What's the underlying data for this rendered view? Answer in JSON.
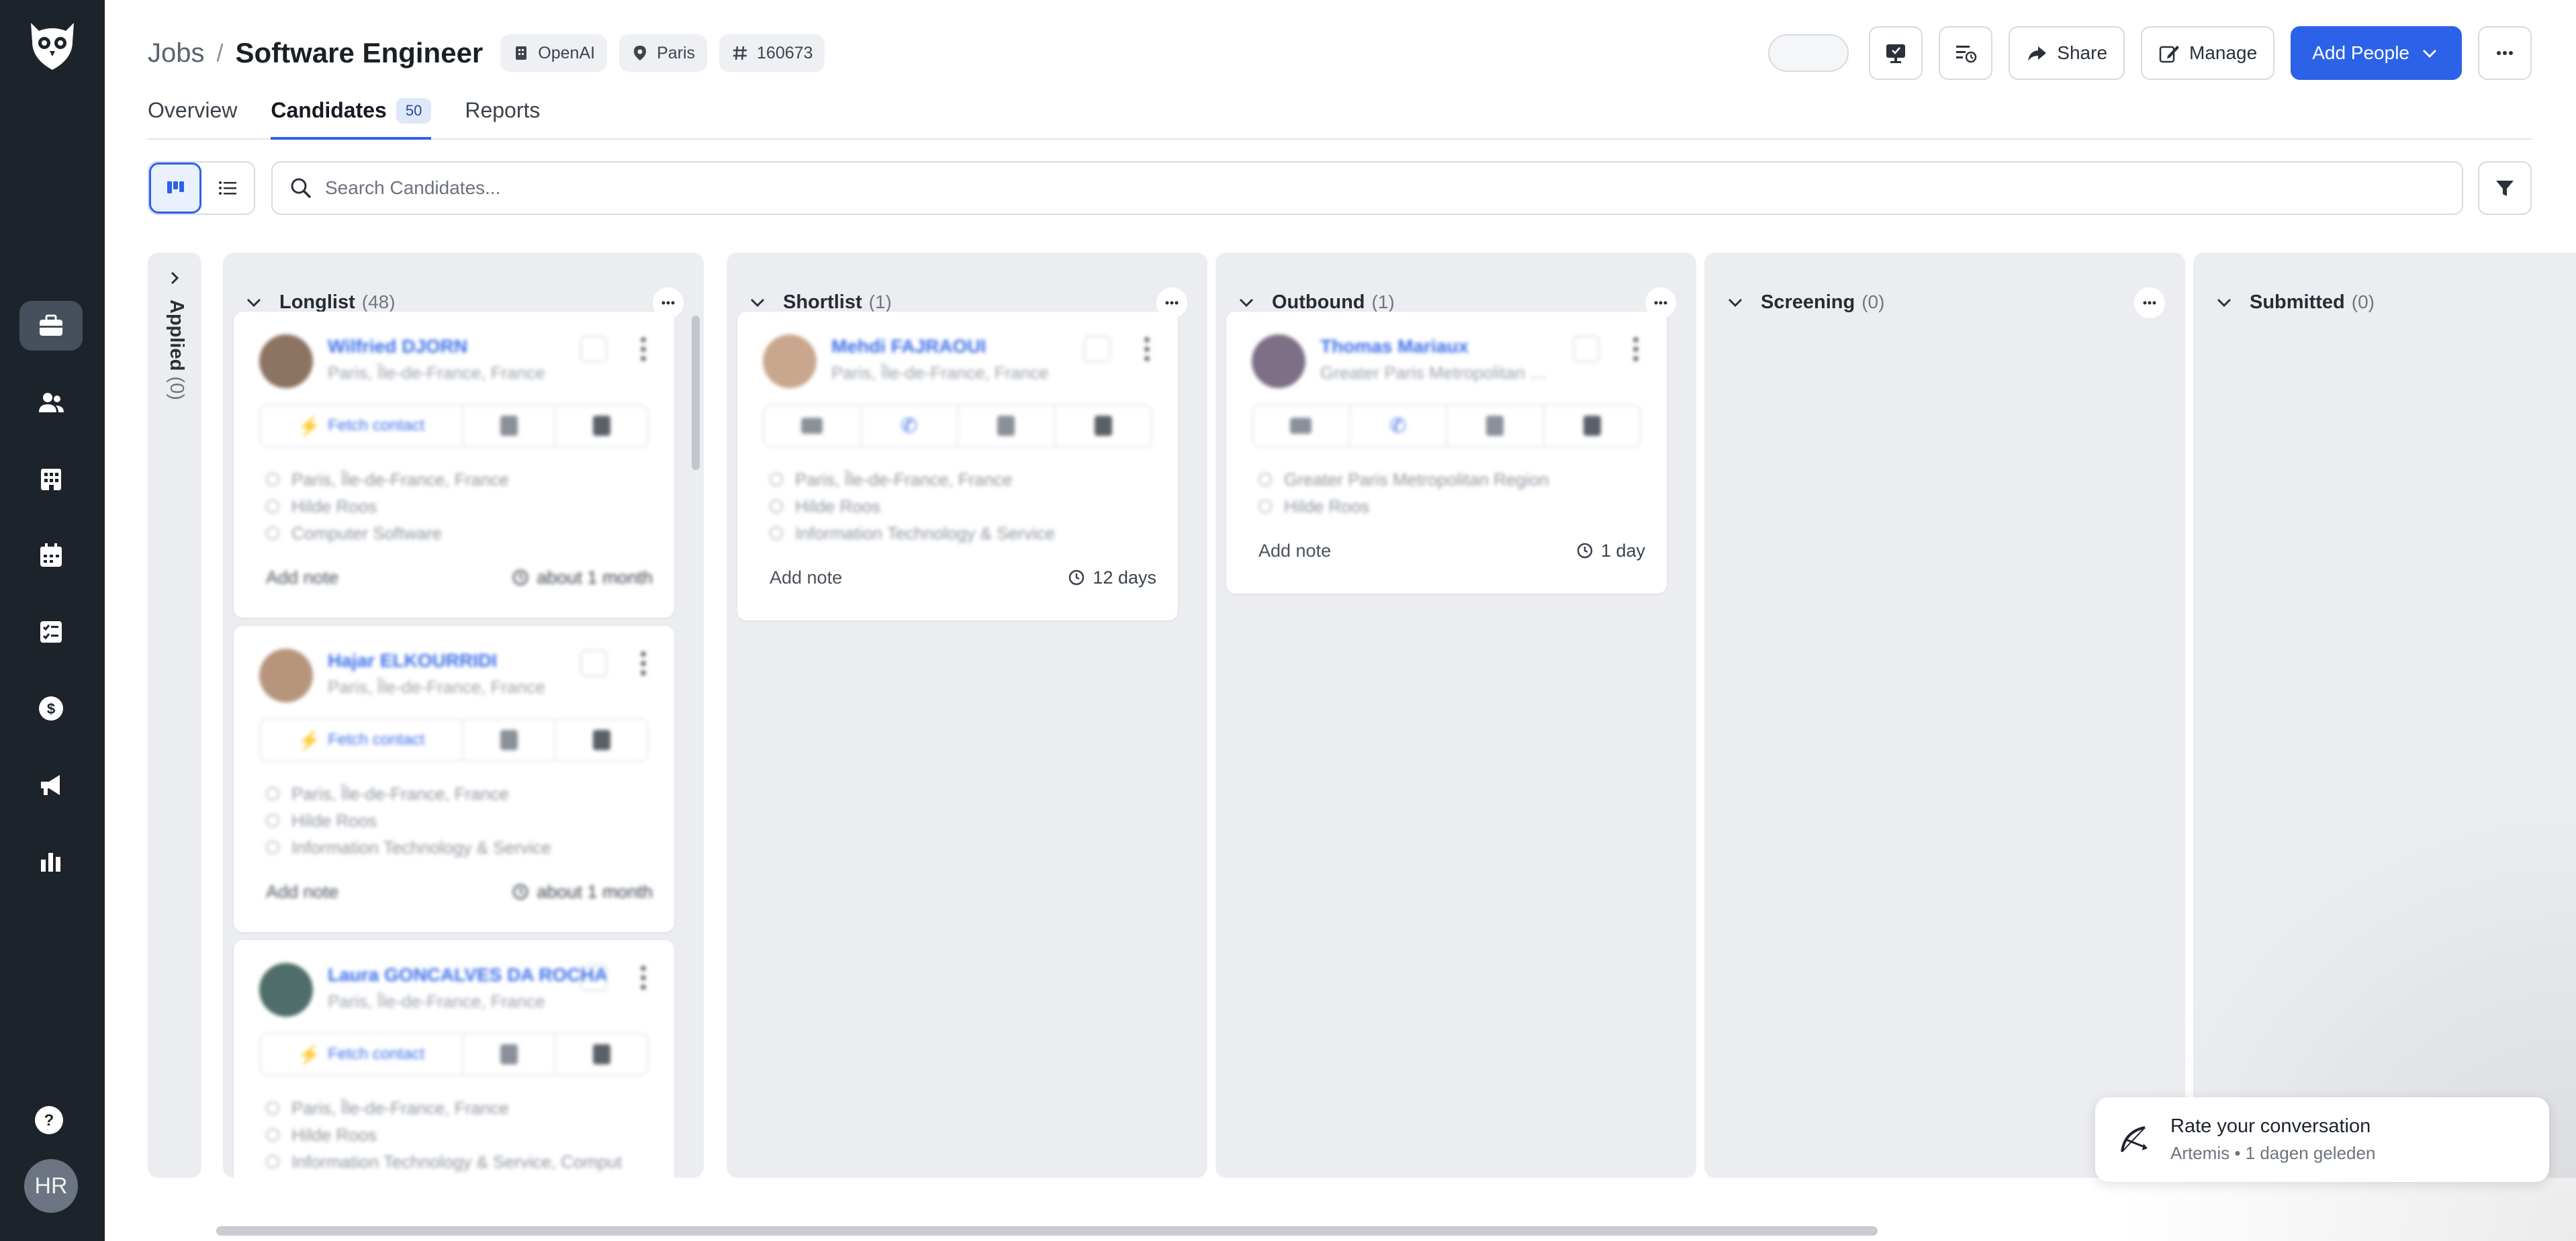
{
  "breadcrumb": {
    "root": "Jobs",
    "separator": "/",
    "title": "Software Engineer"
  },
  "chips": {
    "company": "OpenAI",
    "location": "Paris",
    "job_id": "160673"
  },
  "actions": {
    "share": "Share",
    "manage": "Manage",
    "add_people": "Add People"
  },
  "tabs": [
    {
      "label": "Overview"
    },
    {
      "label": "Candidates",
      "badge": "50"
    },
    {
      "label": "Reports"
    }
  ],
  "search": {
    "placeholder": "Search Candidates..."
  },
  "applied": {
    "label": "Applied",
    "count": "(0)"
  },
  "columns": [
    {
      "title": "Longlist",
      "count": "(48)"
    },
    {
      "title": "Shortlist",
      "count": "(1)"
    },
    {
      "title": "Outbound",
      "count": "(1)"
    },
    {
      "title": "Screening",
      "count": "(0)"
    },
    {
      "title": "Submitted",
      "count": "(0)"
    }
  ],
  "cards": {
    "longlist": [
      {
        "name": "Wilfried DJORN",
        "location": "Paris, Île-de-France, France",
        "fetch": "Fetch contact",
        "info": [
          "Paris, Île-de-France, France",
          "Hilde Roos",
          "Computer Software"
        ],
        "note": "Add note",
        "time": "about 1 month"
      },
      {
        "name": "Hajar ELKOURRIDI",
        "location": "Paris, Île-de-France, France",
        "fetch": "Fetch contact",
        "info": [
          "Paris, Île-de-France, France",
          "Hilde Roos",
          "Information Technology & Service"
        ],
        "note": "Add note",
        "time": "about 1 month"
      },
      {
        "name": "Laura GONCALVES DA ROCHA",
        "location": "Paris, Île-de-France, France",
        "fetch": "Fetch contact",
        "info": [
          "Paris, Île-de-France, France",
          "Hilde Roos",
          "Information Technology & Service, Comput"
        ]
      }
    ],
    "shortlist": [
      {
        "name": "Mehdi FAJRAOUI",
        "location": "Paris, Île-de-France, France",
        "info": [
          "Paris, Île-de-France, France",
          "Hilde Roos",
          "Information Technology & Service"
        ],
        "note": "Add note",
        "time": "12 days"
      }
    ],
    "outbound": [
      {
        "name": "Thomas Mariaux",
        "location": "Greater Paris Metropolitan …",
        "info": [
          "Greater Paris Metropolitan Region",
          "Hilde Roos"
        ],
        "note": "Add note",
        "time": "1 day"
      }
    ]
  },
  "toast": {
    "title": "Rate your conversation",
    "subtitle": "Artemis • 1 dagen geleden"
  },
  "user": {
    "initials": "HR"
  },
  "colors": {
    "sidebar": "#1d232b",
    "accent": "#2c62e8",
    "column_bg": "#ebedf0"
  }
}
